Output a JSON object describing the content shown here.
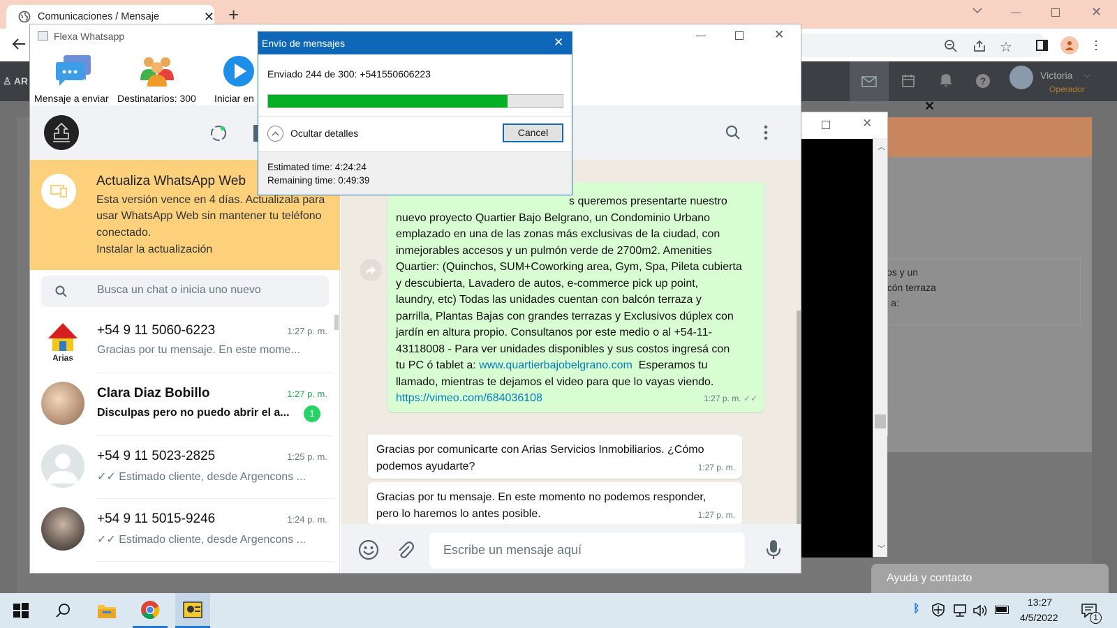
{
  "browser": {
    "tab_title": "Comunicaciones / Mensaje",
    "user_name": "Victoria",
    "user_role": "Operador"
  },
  "background_page": {
    "text_lines": [
      "mejorables accesos y un",
      "s cuentan con balcón terraza",
      "con tu PC ó tablet a:"
    ],
    "help_label": "Ayuda y contacto"
  },
  "flexa": {
    "window_title": "Flexa Whatsapp",
    "tools": [
      {
        "label": "Mensaje a enviar",
        "icon": "message-bubbles-icon"
      },
      {
        "label": "Destinatarios: 300",
        "icon": "people-group-icon"
      },
      {
        "label": "Iniciar en",
        "icon": "play-icon"
      }
    ]
  },
  "dialog": {
    "title": "Envío de mensajes",
    "status": "Enviado 244 de 300: +541550606223",
    "progress": 0.813,
    "toggle_label": "Ocultar detalles",
    "cancel_label": "Cancel",
    "estimated": "Estimated time: 4:24:24",
    "remaining": "Remaining time: 0:49:39"
  },
  "whatsapp": {
    "banner": {
      "title": "Actualiza WhatsApp Web",
      "body": "Esta versión vence en 4 días. Actualizala para usar WhatsApp Web sin mantener tu teléfono conectado.",
      "link": "Instalar la actualización"
    },
    "search_placeholder": "Busca un chat o inicia uno nuevo",
    "chats": [
      {
        "name": "+54 9 11 5060-6223",
        "time": "1:27 p. m.",
        "preview": "Gracias por tu mensaje. En este mome...",
        "unread": ""
      },
      {
        "name": "Clara Diaz Bobillo",
        "time": "1:27 p. m.",
        "preview": "Disculpas pero no puedo abrir el a...",
        "unread": "1"
      },
      {
        "name": "+54 9 11 5023-2825",
        "time": "1:25 p. m.",
        "preview": "Estimado cliente, desde Argencons ...",
        "unread": ""
      },
      {
        "name": "+54 9 11 5015-9246",
        "time": "1:24 p. m.",
        "preview": "Estimado cliente, desde Argencons ...",
        "unread": ""
      }
    ],
    "messages": {
      "outgoing_lines": [
        "s queremos presentarte nuestro",
        "nuevo proyecto Quartier Bajo Belgrano, un Condominio Urbano",
        "emplazado en una de las zonas más exclusivas de la ciudad, con",
        "inmejorables accesos y un pulmón verde de 2700m2. Amenities",
        "Quartier: (Quinchos, SUM+Coworking area, Gym, Spa, Pileta cubierta",
        "y descubierta, Lavadero de autos, e-commerce pick up point,",
        "laundry, etc)  Todas las unidades cuentan con balcón terraza y",
        "parrilla, Plantas Bajas con grandes terrazas y Exclusivos dúplex con",
        "jardín en altura propio. Consultanos por este medio o al +54-11-",
        "43118008  - Para ver unidades disponibles y sus costos ingresá con"
      ],
      "outgoing_pre_link": "tu PC ó tablet a: ",
      "outgoing_link": "www.quartierbajobelgrano.com",
      "outgoing_post_link": "  Esperamos tu",
      "outgoing_line_last": "llamado, mientras te dejamos el video para que lo vayas viendo.",
      "outgoing_video": "https://vimeo.com/684036108",
      "outgoing_time": "1:27 p. m.",
      "incoming": [
        {
          "text": "Gracias por comunicarte con Arias Servicios Inmobiliarios. ¿Cómo podemos ayudarte?",
          "time": "1:27 p. m."
        },
        {
          "text": "Gracias por tu mensaje. En este momento no podemos responder, pero lo haremos lo antes posible.",
          "time": "1:27 p. m."
        }
      ]
    },
    "compose_placeholder": "Escribe un mensaje aquí"
  },
  "taskbar": {
    "time": "13:27",
    "date": "4/5/2022",
    "notifications": "1"
  },
  "colors": {
    "wa_green": "#25d366",
    "progress_green": "#06b025",
    "dialog_blue": "#0f67b8",
    "banner_yellow": "#fdd07c"
  }
}
